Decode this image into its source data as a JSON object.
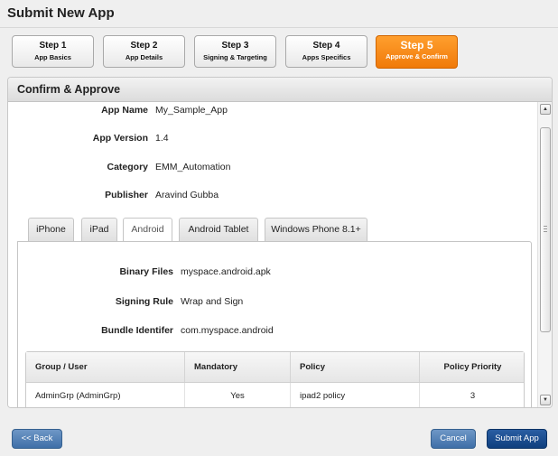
{
  "page": {
    "title": "Submit New App"
  },
  "steps": [
    {
      "num": "Step 1",
      "label": "App Basics"
    },
    {
      "num": "Step 2",
      "label": "App Details"
    },
    {
      "num": "Step 3",
      "label": "Signing & Targeting"
    },
    {
      "num": "Step 4",
      "label": "Apps Specifics"
    },
    {
      "num": "Step 5",
      "label": "Approve & Confirm",
      "active": true
    }
  ],
  "panel": {
    "title": "Confirm & Approve"
  },
  "app_info": {
    "app_name_label": "App Name",
    "app_name": "My_Sample_App",
    "app_version_label": "App Version",
    "app_version": "1.4",
    "category_label": "Category",
    "category": "EMM_Automation",
    "publisher_label": "Publisher",
    "publisher": "Aravind Gubba"
  },
  "tabs": [
    "iPhone",
    "iPad",
    "Android",
    "Android Tablet",
    "Windows Phone 8.1+"
  ],
  "active_tab": "Android",
  "android": {
    "binary_files_label": "Binary Files",
    "binary_files": "myspace.android.apk",
    "signing_rule_label": "Signing Rule",
    "signing_rule": "Wrap and Sign",
    "bundle_id_label": "Bundle Identifer",
    "bundle_id": "com.myspace.android"
  },
  "grid": {
    "columns": [
      "Group / User",
      "Mandatory",
      "Policy",
      "Policy Priority"
    ],
    "rows": [
      {
        "group": "AdminGrp (AdminGrp)",
        "mandatory": "Yes",
        "policy": "ipad2 policy",
        "priority": "3"
      }
    ]
  },
  "buttons": {
    "back": "<< Back",
    "cancel": "Cancel",
    "submit": "Submit App"
  },
  "colors": {
    "active_step": "#f58a12",
    "primary_button": "#1a4c8f",
    "secondary_button": "#5683b8"
  }
}
